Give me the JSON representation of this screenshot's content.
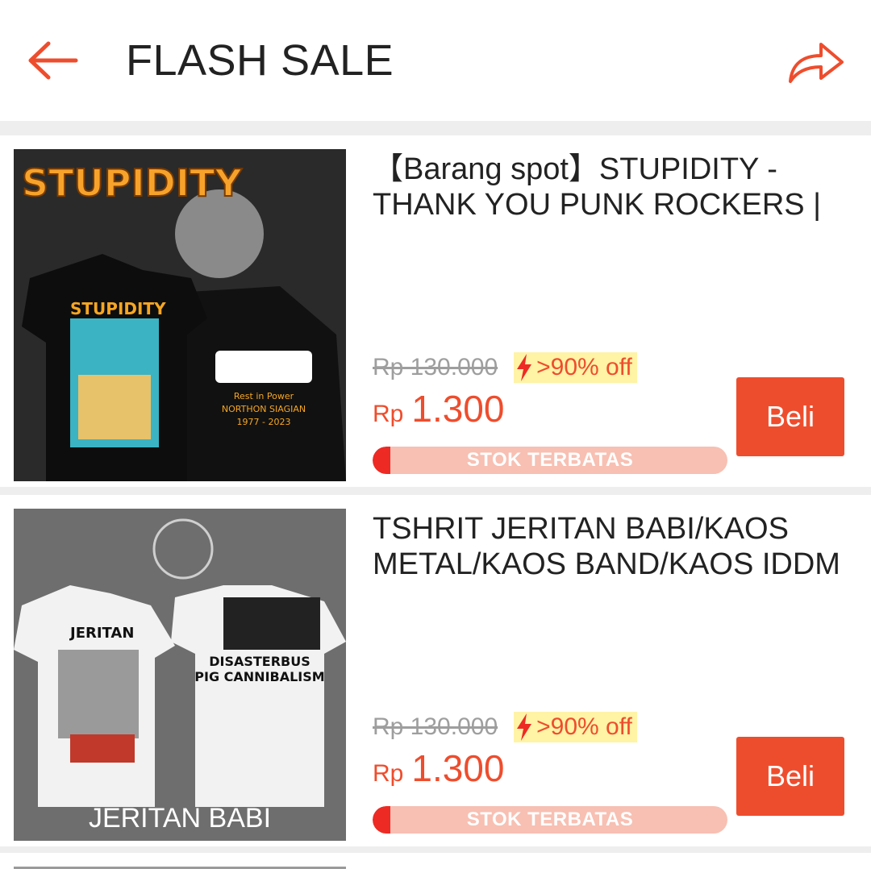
{
  "header": {
    "title": "FLASH SALE",
    "back_icon": "arrow-left-icon",
    "share_icon": "share-arrow-icon"
  },
  "colors": {
    "accent": "#ee4d2d",
    "discount_bg": "#fff3a6",
    "stock_bar_bg": "#f7c0b3",
    "stock_bar_fill": "#ee2a24"
  },
  "items": [
    {
      "name": "【Barang spot】STUPIDITY - THANK YOU PUNK ROCKERS | ...",
      "image_text": "STUPIDITY",
      "price_old": "Rp 130.000",
      "discount": ">90% off",
      "price_currency": "Rp",
      "price_value": "1.300",
      "stock_label": "STOK TERBATAS",
      "stock_fill_fraction": 0.05,
      "buy_label": "Beli"
    },
    {
      "name": "TSHRIT JERITAN BABI/KAOS METAL/KAOS BAND/KAOS IDDM",
      "image_text": "JERITAN BABI",
      "price_old": "Rp 130.000",
      "discount": ">90% off",
      "price_currency": "Rp",
      "price_value": "1.300",
      "stock_label": "STOK TERBATAS",
      "stock_fill_fraction": 0.05,
      "buy_label": "Beli"
    }
  ]
}
